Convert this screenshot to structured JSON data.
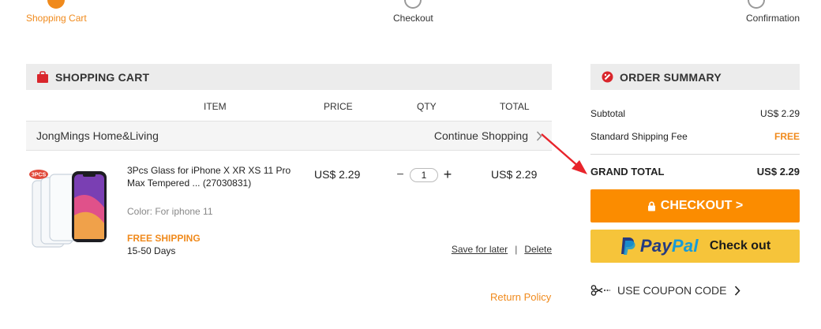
{
  "steps": [
    {
      "label": "Shopping Cart",
      "active": true
    },
    {
      "label": "Checkout",
      "active": false
    },
    {
      "label": "Confirmation",
      "active": false
    }
  ],
  "cart": {
    "title": "SHOPPING CART",
    "columns": {
      "item": "ITEM",
      "price": "PRICE",
      "qty": "QTY",
      "total": "TOTAL"
    },
    "store_name": "JongMings Home&Living",
    "continue_label": "Continue Shopping",
    "item": {
      "title": "3Pcs Glass for iPhone X XR XS 11 Pro Max Tempered ... (27030831)",
      "thumb_badge": "3PCS",
      "color": "Color: For iphone 11",
      "shipping": "FREE SHIPPING",
      "delivery": "15-50 Days",
      "price": "US$ 2.29",
      "qty": "1",
      "qty_minus": "−",
      "qty_plus": "+",
      "total": "US$ 2.29",
      "save_label": "Save for later",
      "delete_label": "Delete"
    },
    "return_policy": "Return Policy"
  },
  "summary": {
    "title": "ORDER SUMMARY",
    "subtotal_label": "Subtotal",
    "subtotal_value": "US$ 2.29",
    "shipping_label": "Standard Shipping Fee",
    "shipping_value": "FREE",
    "grand_label": "GRAND TOTAL",
    "grand_value": "US$ 2.29",
    "checkout_label": "CHECKOUT >",
    "paypal_check": "Check out",
    "coupon_label": "USE COUPON CODE"
  },
  "colors": {
    "accent": "#f08a1c",
    "checkout": "#fb8c00",
    "paypal_bg": "#f6c43a",
    "arrow": "#e8242b"
  },
  "icons": [
    "bag-icon",
    "order-summary-icon",
    "lock-icon",
    "paypal-logo-icon",
    "scissors-icon",
    "chevron-right-icon",
    "annotation-arrow-icon"
  ]
}
